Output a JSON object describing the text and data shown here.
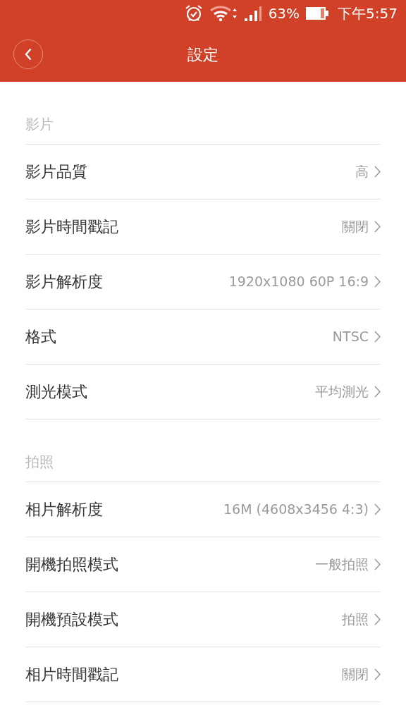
{
  "status_bar": {
    "battery": "63%",
    "time": "下午5:57"
  },
  "header": {
    "title": "設定"
  },
  "sections": [
    {
      "title": "影片",
      "items": [
        {
          "label": "影片品質",
          "value": "高"
        },
        {
          "label": "影片時間戳記",
          "value": "關閉"
        },
        {
          "label": "影片解析度",
          "value": "1920x1080 60P 16:9"
        },
        {
          "label": "格式",
          "value": "NTSC"
        },
        {
          "label": "測光模式",
          "value": "平均測光"
        }
      ]
    },
    {
      "title": "拍照",
      "items": [
        {
          "label": "相片解析度",
          "value": "16M (4608x3456 4:3)"
        },
        {
          "label": "開機拍照模式",
          "value": "一般拍照"
        },
        {
          "label": "開機預設模式",
          "value": "拍照"
        },
        {
          "label": "相片時間戳記",
          "value": "關閉"
        }
      ]
    }
  ]
}
